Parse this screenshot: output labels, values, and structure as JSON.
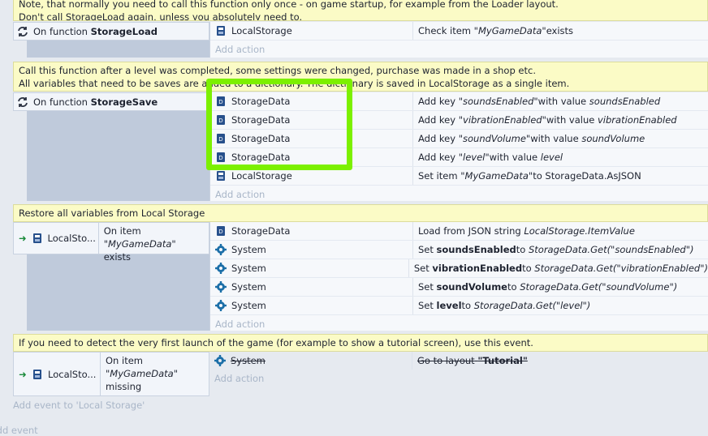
{
  "comments": {
    "c0": {
      "line1": "Note, that normally you need to call this function only once - on game startup, for example from the Loader layout.",
      "line2": "Don't call StorageLoad again, unless you absolutely need to."
    },
    "c1": {
      "line1": "Call this function after a level was completed, some settings were changed, purchase was made in a shop etc.",
      "line2": "All variables that need to be saves are added to a dictionary. The dictionary is saved in LocalStorage as a single item."
    },
    "c2": {
      "line1": "Restore all variables from Local Storage"
    },
    "c3": {
      "line1": "If you need to detect the very first launch of the game (for example to show a tutorial screen), use this event."
    }
  },
  "events": {
    "storage_load": {
      "prefix": "On function",
      "name": "StorageLoad",
      "actions": [
        {
          "object": "LocalStorage",
          "pre": "Check item ",
          "arg": "\"MyGameData\"",
          "post": " exists"
        }
      ],
      "add_action": "Add action"
    },
    "storage_save": {
      "prefix": "On function",
      "name": "StorageSave",
      "actions": [
        {
          "object": "StorageData",
          "pre": "Add key ",
          "key": "\"soundsEnabled\"",
          "mid": " with value ",
          "val": "soundsEnabled"
        },
        {
          "object": "StorageData",
          "pre": "Add key ",
          "key": "\"vibrationEnabled\"",
          "mid": " with value ",
          "val": "vibrationEnabled"
        },
        {
          "object": "StorageData",
          "pre": "Add key ",
          "key": "\"soundVolume\"",
          "mid": " with value ",
          "val": "soundVolume"
        },
        {
          "object": "StorageData",
          "pre": "Add key ",
          "key": "\"level\"",
          "mid": " with value ",
          "val": "level"
        },
        {
          "object": "LocalStorage",
          "pre": "Set item ",
          "key": "\"MyGameData\"",
          "mid": " to StorageData.AsJSON",
          "val": ""
        }
      ],
      "add_action": "Add action"
    },
    "restore": {
      "object": "LocalSto...",
      "cond_line1": "On item",
      "cond_arg": "\"MyGameData\"",
      "cond_post": " exists",
      "actions": [
        {
          "object": "StorageData",
          "pre": "Load from JSON string ",
          "bold": "",
          "mid": "",
          "val": "LocalStorage.ItemValue"
        },
        {
          "object": "System",
          "pre": "Set ",
          "bold": "soundsEnabled",
          "mid": " to ",
          "val": "StorageData.Get(\"soundsEnabled\")"
        },
        {
          "object": "System",
          "pre": "Set ",
          "bold": "vibrationEnabled",
          "mid": " to ",
          "val": "StorageData.Get(\"vibrationEnabled\")"
        },
        {
          "object": "System",
          "pre": "Set ",
          "bold": "soundVolume",
          "mid": " to ",
          "val": "StorageData.Get(\"soundVolume\")"
        },
        {
          "object": "System",
          "pre": "Set ",
          "bold": "level",
          "mid": " to ",
          "val": "StorageData.Get(\"level\")"
        }
      ],
      "add_action": "Add action"
    },
    "first_launch": {
      "object": "LocalSto...",
      "cond_line1": "On item",
      "cond_arg": "\"MyGameData\"",
      "cond_line3": "missing",
      "actions": [
        {
          "object": "System",
          "pre": "Go to layout ",
          "bold": "\"Tutorial\""
        }
      ],
      "add_action": "Add action"
    }
  },
  "footer": {
    "add_event": "Add event to 'Local Storage'",
    "bottom_text": "Add event"
  },
  "colors": {
    "comment_bg": "#fbfbc6",
    "event_bar": "#bfcadb",
    "highlight": "#7cf000",
    "add_text": "#a9b6c8"
  }
}
